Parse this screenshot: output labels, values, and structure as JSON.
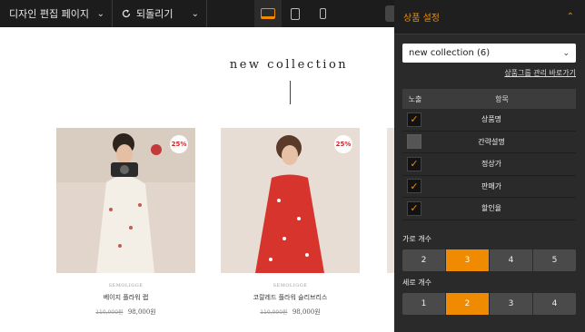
{
  "toolbar": {
    "page_select": "디자인 편집 페이지",
    "undo_label": "되돌리기",
    "undo_icon": "undo-icon",
    "devices": [
      {
        "icon": "desktop-icon",
        "active": true
      },
      {
        "icon": "tablet-icon",
        "active": false
      },
      {
        "icon": "mobile-icon",
        "active": false
      }
    ],
    "accent_color": "#f08a00"
  },
  "canvas": {
    "section_title": "new collection",
    "products": [
      {
        "brand": "SEMOLIGGE",
        "name": "베이지 플라워 랩",
        "old_price": "110,000원",
        "price": "98,000원",
        "discount": "25%"
      },
      {
        "brand": "SEMOLIGGE",
        "name": "코랄레드 플라워 슬리브리스",
        "old_price": "110,000원",
        "price": "98,000원",
        "discount": "25%"
      }
    ]
  },
  "panel": {
    "title": "상품 설정",
    "collapse_icon": "chevron-up-icon",
    "collection": "new collection (6)",
    "manage_link": "상품그룹 관리 바로가기",
    "table": {
      "col_visible": "노출",
      "col_item": "항목",
      "rows": [
        {
          "label": "상품명",
          "checked": true
        },
        {
          "label": "간략설명",
          "checked": false
        },
        {
          "label": "정상가",
          "checked": true
        },
        {
          "label": "판매가",
          "checked": true
        },
        {
          "label": "할인율",
          "checked": true
        }
      ]
    },
    "columns": {
      "label": "가로 개수",
      "options": [
        "2",
        "3",
        "4",
        "5"
      ],
      "selected": "3"
    },
    "rows_count": {
      "label": "세로 개수",
      "options": [
        "1",
        "2",
        "3",
        "4"
      ],
      "selected": "2"
    }
  }
}
